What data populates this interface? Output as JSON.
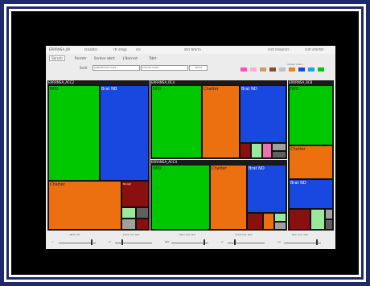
{
  "menu": {
    "left": [
      "ERRRNSA_JM",
      "tcnsbtsr",
      "rtr smgs",
      "rcs"
    ],
    "center": "stcr bmrrn",
    "right": [
      "rcct rsnssnrrr",
      "rcnt smrrtsr"
    ]
  },
  "tabs": [
    "Sbrsstr",
    "Rnsmtr",
    "Snrmnr abrrt",
    "J Nocnsrt",
    "Tsbrt"
  ],
  "controls": {
    "label": "Snrtr",
    "field1": "bjrtbntrnrmt nrsst",
    "field2": "smrrrnt rsnsn",
    "button": "Rnrnt",
    "colors": [
      "#ff4fb0",
      "#ffb0d0",
      "#c0a070",
      "#7a5030",
      "#c0c0c0",
      "#f08020",
      "#1848e0",
      "#20a0f0",
      "#00c800"
    ],
    "swatch_note": "rsrsssr rsrsrn"
  },
  "treemap": {
    "panel1": {
      "title": "ERRRNSA_ACC2",
      "cells": [
        "NPD",
        "Brat NB",
        "Chatter",
        "Brsrgtr"
      ]
    },
    "panel2": {
      "title": "ERRRNSA_RC4",
      "cells": [
        "NPD",
        "Chatter",
        "Brat ND"
      ]
    },
    "panel3": {
      "title": "ERRRNSA_ACC4",
      "cells": [
        "NPD",
        "Chatter",
        "Brat ND"
      ]
    },
    "panel4": {
      "title": "ERRRNSA_RCB",
      "cells": [
        "NPD",
        "Chatter",
        "Brat ND"
      ]
    }
  },
  "sliders": [
    {
      "title": "Nbrt srtr",
      "value": "r"
    },
    {
      "title": "snhrt srsr sbrt",
      "value": "sr"
    },
    {
      "title": "stbrr srsr sbrt",
      "value": "Nbt"
    },
    {
      "title": "snhrt srsr sbrt",
      "value": "sr"
    },
    {
      "title": "stbrr srsr sbrt",
      "value": "rsr"
    }
  ]
}
